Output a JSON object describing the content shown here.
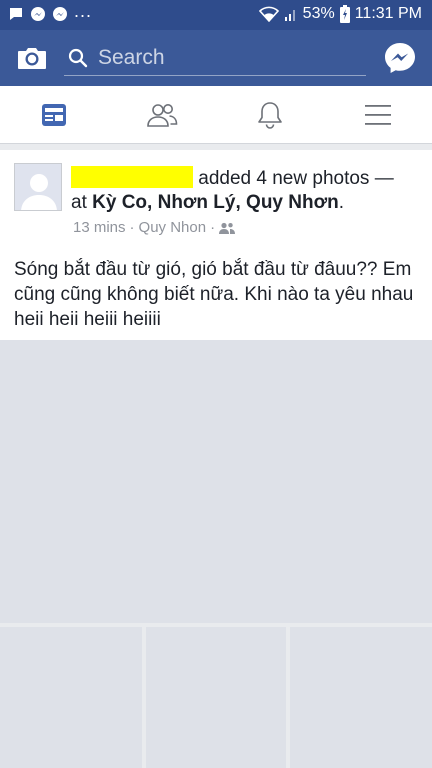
{
  "status_bar": {
    "battery": "53%",
    "time": "11:31 PM",
    "overflow": "..."
  },
  "app_bar": {
    "search_placeholder": "Search"
  },
  "tabs": [
    {
      "name": "news-feed",
      "icon": "news-feed-icon",
      "active": true
    },
    {
      "name": "friends",
      "icon": "friends-icon",
      "active": false
    },
    {
      "name": "notifications",
      "icon": "bell-icon",
      "active": false
    },
    {
      "name": "menu",
      "icon": "hamburger-menu-icon",
      "active": false
    }
  ],
  "post": {
    "action": "added 4 new photos —",
    "at_prefix": "at",
    "location": "Kỳ Co, Nhơn Lý, Quy Nhơn",
    "location_suffix": ".",
    "time_ago": "13 mins",
    "separator": "·",
    "place": "Quy Nhon",
    "separator2": "·",
    "text": "Sóng bắt đầu từ gió, gió bắt đầu từ đâuu?? Em cũng cũng không biết nữa. Khi nào ta yêu nhau heii heii heiii heiiii"
  },
  "colors": {
    "brand": "#3b5998",
    "status_bar": "#2f4c8c",
    "active_tab": "#4267b2",
    "redaction": "#ffff00"
  }
}
